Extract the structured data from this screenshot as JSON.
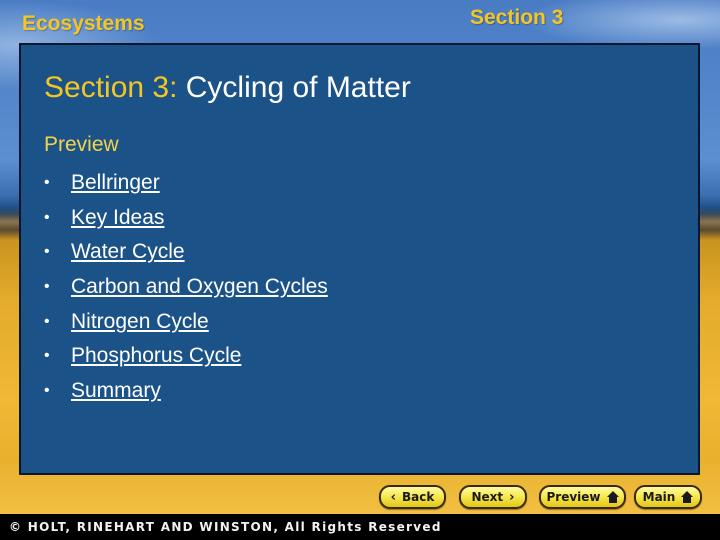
{
  "header": {
    "chapter": "Ecosystems",
    "section_badge": "Section 3"
  },
  "slide": {
    "title_prefix": "Section 3:",
    "title_name": "Cycling of Matter",
    "preview_label": "Preview",
    "items": [
      {
        "label": "Bellringer"
      },
      {
        "label": "Key Ideas"
      },
      {
        "label": "Water Cycle"
      },
      {
        "label": "Carbon and Oxygen Cycles"
      },
      {
        "label": "Nitrogen Cycle"
      },
      {
        "label": "Phosphorus Cycle"
      },
      {
        "label": "Summary"
      }
    ],
    "bullet": "•"
  },
  "nav": {
    "back": {
      "label": "Back",
      "icon": "chevron-left-icon",
      "glyph": "‹"
    },
    "next": {
      "label": "Next",
      "icon": "chevron-right-icon",
      "glyph": "›"
    },
    "preview": {
      "label": "Preview",
      "icon": "home-icon"
    },
    "main": {
      "label": "Main",
      "icon": "home-icon"
    }
  },
  "footer": {
    "copyright": "© HOLT, RINEHART AND WINSTON, All Rights Reserved"
  },
  "colors": {
    "accent_yellow": "#f3c623",
    "panel_blue": "#1b5288",
    "button_yellow": "#f7ea50"
  }
}
